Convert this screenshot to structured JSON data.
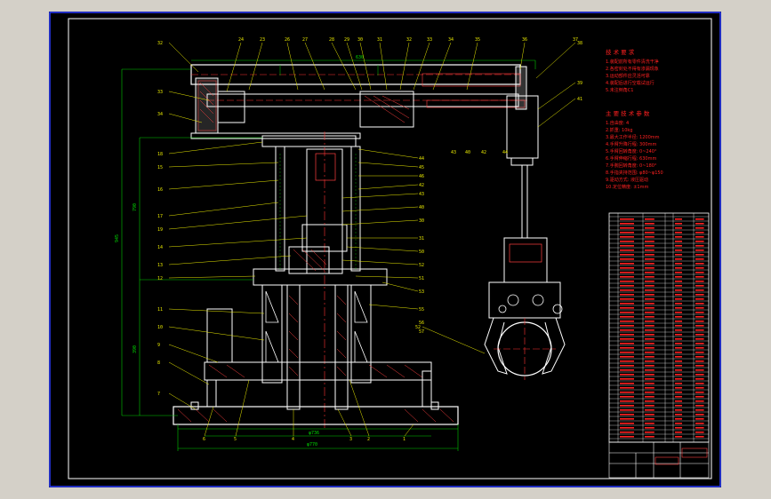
{
  "part_numbers": {
    "left": [
      "32",
      "33",
      "34",
      "18",
      "15",
      "16",
      "17",
      "19",
      "14",
      "13",
      "12",
      "11",
      "10",
      "9",
      "8",
      "7"
    ],
    "top": [
      "24",
      "23",
      "26",
      "27",
      "28",
      "29",
      "30",
      "31",
      "32",
      "33",
      "34",
      "35",
      "36",
      "37"
    ],
    "right_mid": [
      "44",
      "45",
      "46",
      "42",
      "43",
      "40",
      "30",
      "31",
      "50",
      "52",
      "51",
      "53",
      "55",
      "56",
      "57"
    ],
    "bottom": [
      "6",
      "5",
      "4",
      "3",
      "2",
      "1"
    ],
    "right_arm": [
      "38",
      "39",
      "41",
      "40",
      "42",
      "43",
      "44"
    ],
    "gripper": "52"
  },
  "dimensions": {
    "height_total": "945",
    "height_upper": "790",
    "height_lower": "390",
    "width_base": "φ770",
    "width_inner": "φ736",
    "stroke_top": "630"
  },
  "tech_req": {
    "title": "技 术 要 求",
    "lines": [
      "1.装配前所有零件清洗干净",
      "2.各密封处不得有渗漏现象",
      "3.运动部件应灵活可靠",
      "4.装配后进行空载试运行",
      "5.未注倒角C1"
    ]
  },
  "params": {
    "title": "主 要 技 术 参 数",
    "lines": [
      "1.自由度: 4",
      "2.抓重: 10kg",
      "3.最大工作半径: 1200mm",
      "4.手臂升降行程: 300mm",
      "5.手臂回转角度: 0~240°",
      "6.手臂伸缩行程: 630mm",
      "7.手腕回转角度: 0~180°",
      "8.手指夹持范围: φ80~φ150",
      "9.驱动方式: 液压驱动",
      "10.定位精度: ±1mm"
    ]
  }
}
